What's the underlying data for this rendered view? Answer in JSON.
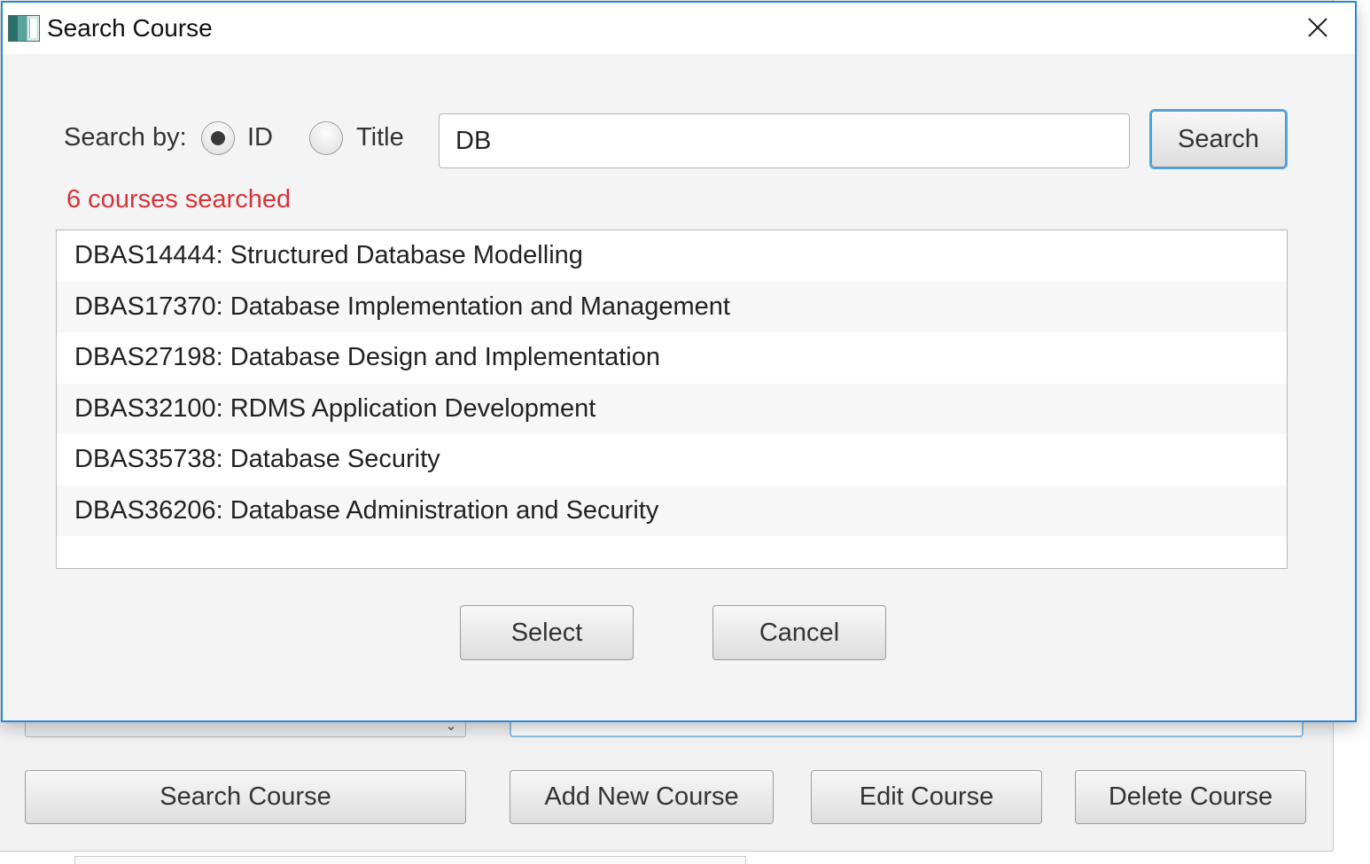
{
  "background_window": {
    "buttons": {
      "search_course": "Search Course",
      "add_new_course": "Add New Course",
      "edit_course": "Edit Course",
      "delete_course": "Delete Course"
    },
    "combo_arrow_icon": "chevron-down-icon"
  },
  "dialog": {
    "title": "Search Course",
    "close_icon": "close-icon",
    "search_by_label": "Search by:",
    "radio_options": [
      {
        "label": "ID",
        "selected": true
      },
      {
        "label": "Title",
        "selected": false
      }
    ],
    "search_input_value": "DB",
    "search_button_label": "Search",
    "status_text": "6 courses searched",
    "status_color": "#d4343a",
    "accent_color": "#2b88d8",
    "results": [
      "DBAS14444: Structured Database Modelling",
      "DBAS17370: Database Implementation and Management",
      "DBAS27198: Database Design and Implementation",
      "DBAS32100: RDMS Application Development",
      "DBAS35738: Database Security",
      "DBAS36206: Database Administration and Security"
    ],
    "select_button_label": "Select",
    "cancel_button_label": "Cancel"
  }
}
